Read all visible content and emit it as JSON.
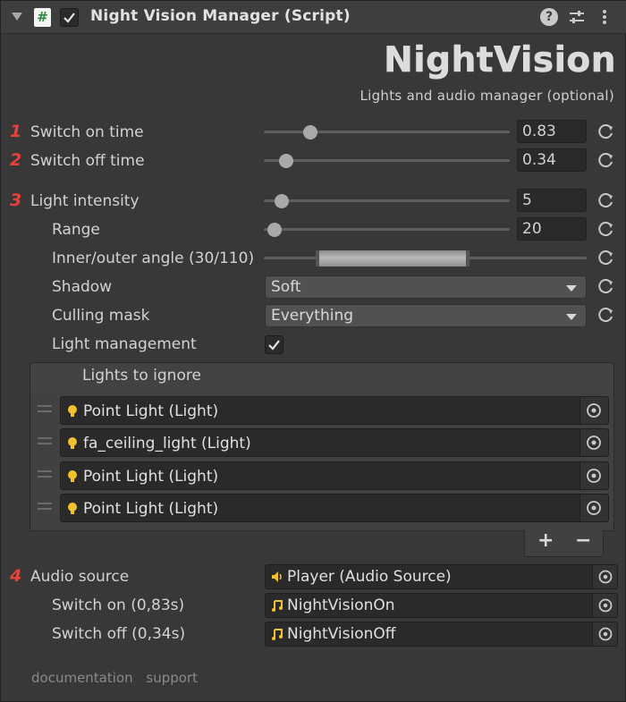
{
  "header": {
    "title": "Night Vision Manager (Script)",
    "script_icon_glyph": "#",
    "help_glyph": "?"
  },
  "brand": {
    "logo": "NightVision",
    "subtitle": "Lights and audio manager (optional)"
  },
  "annotations": [
    "1",
    "2",
    "3",
    "4"
  ],
  "fields": {
    "switch_on_time": {
      "label": "Switch on time",
      "value": "0.83",
      "slider": 0.19
    },
    "switch_off_time": {
      "label": "Switch off time",
      "value": "0.34",
      "slider": 0.09
    },
    "light_intensity": {
      "label": "Light intensity",
      "value": "5",
      "slider": 0.08
    },
    "range": {
      "label": "Range",
      "value": "20",
      "slider": 0.05
    },
    "inner_outer_angle": {
      "label": "Inner/outer angle (30/110)",
      "min": 30,
      "max": 110
    },
    "shadow": {
      "label": "Shadow",
      "value": "Soft"
    },
    "culling_mask": {
      "label": "Culling mask",
      "value": "Everything"
    },
    "light_management": {
      "label": "Light management",
      "checked": true
    }
  },
  "lights_to_ignore": {
    "header": "Lights to ignore",
    "items": [
      "Point Light (Light)",
      "fa_ceiling_light (Light)",
      "Point Light (Light)",
      "Point Light (Light)"
    ],
    "add_label": "+",
    "remove_label": "−"
  },
  "audio": {
    "audio_source": {
      "label": "Audio source",
      "value": "Player (Audio Source)"
    },
    "switch_on": {
      "label": "Switch on (0,83s)",
      "value": "NightVisionOn"
    },
    "switch_off": {
      "label": "Switch off (0,34s)",
      "value": "NightVisionOff"
    }
  },
  "links": {
    "documentation": "documentation",
    "support": "support"
  },
  "colors": {
    "annotation_red": "#e8413c",
    "bulb_yellow": "#f2c12e",
    "panel_bg": "#383838"
  }
}
